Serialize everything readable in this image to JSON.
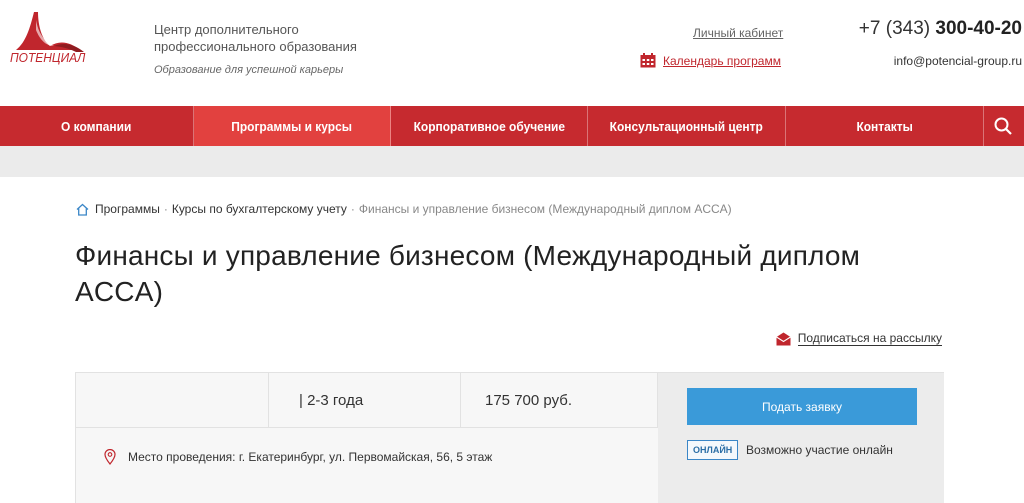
{
  "header": {
    "logo_text": "ПОТЕНЦИАЛ",
    "org_line1": "Центр дополнительного",
    "org_line2": "профессионального образования",
    "slogan": "Образование для успешной карьеры",
    "cabinet_link": "Личный кабинет",
    "calendar_link": "Календарь программ",
    "phone_prefix": "+7 (343) ",
    "phone_number": "300-40-20",
    "email": "info@potencial-group.ru"
  },
  "nav": {
    "items": [
      {
        "label": "О компании"
      },
      {
        "label": "Программы и курсы"
      },
      {
        "label": "Корпоративное обучение"
      },
      {
        "label": "Консультационный центр"
      },
      {
        "label": "Контакты"
      }
    ],
    "active_index": 1,
    "search_icon": "search-icon"
  },
  "breadcrumb": {
    "home_icon": "home-icon",
    "items": [
      "Программы",
      "Курсы по бухгалтерскому учету"
    ],
    "separator": "·",
    "current": "Финансы и управление бизнесом (Международный диплом ACCA)"
  },
  "page": {
    "title": "Финансы и управление бизнесом (Международный диплом ACCA)",
    "subscribe_label": "Подписаться на рассылку"
  },
  "course": {
    "cell1": "",
    "duration": "| 2-3 года",
    "price": "175 700 руб.",
    "location": "Место проведения: г. Екатеринбург, ул. Первомайская, 56, 5 этаж",
    "apply_button": "Подать заявку",
    "online_badge": "ОНЛАЙН",
    "online_text": "Возможно участие онлайн"
  },
  "colors": {
    "brand_red": "#c62a2f",
    "nav_active": "#e2413f",
    "button_blue": "#3a9ad9"
  }
}
